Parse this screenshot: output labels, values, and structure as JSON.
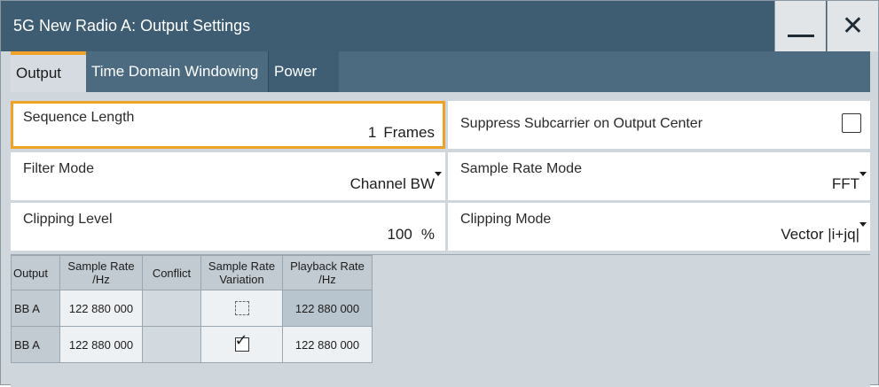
{
  "window": {
    "title": "5G New Radio A: Output Settings",
    "minimize_glyph": "minimize",
    "close_glyph": "✕"
  },
  "tabs": [
    {
      "label": "Output",
      "active": true
    },
    {
      "label": "Time Domain Windowing",
      "active": false
    },
    {
      "label": "Power",
      "active": false
    }
  ],
  "fields": {
    "sequence_length": {
      "label": "Sequence Length",
      "value": "1",
      "unit": "Frames"
    },
    "suppress_subcarrier": {
      "label": "Suppress Subcarrier on Output Center",
      "checked": false
    },
    "filter_mode": {
      "label": "Filter Mode",
      "value": "Channel BW"
    },
    "sample_rate_mode": {
      "label": "Sample Rate Mode",
      "value": "FFT"
    },
    "clipping_level": {
      "label": "Clipping Level",
      "value": "100",
      "unit": "%"
    },
    "clipping_mode": {
      "label": "Clipping Mode",
      "value": "Vector |i+jq|"
    }
  },
  "table": {
    "headers": {
      "output": "Output",
      "sample_rate_1": "Sample Rate",
      "sample_rate_2": "/Hz",
      "conflict": "Conflict",
      "variation_1": "Sample Rate",
      "variation_2": "Variation",
      "playback_1": "Playback Rate",
      "playback_2": "/Hz"
    },
    "rows": [
      {
        "output": "BB A",
        "sample_rate": "122 880 000",
        "conflict": "",
        "variation": false,
        "playback_rate": "122 880 000"
      },
      {
        "output": "BB A",
        "sample_rate": "122 880 000",
        "conflict": "",
        "variation": true,
        "playback_rate": "122 880 000"
      }
    ]
  },
  "colors": {
    "title_bar": "#3e5c72",
    "tab_bar": "#4c6a80",
    "focus_accent": "#f0a228",
    "panel_bg": "#cfd6dc"
  }
}
